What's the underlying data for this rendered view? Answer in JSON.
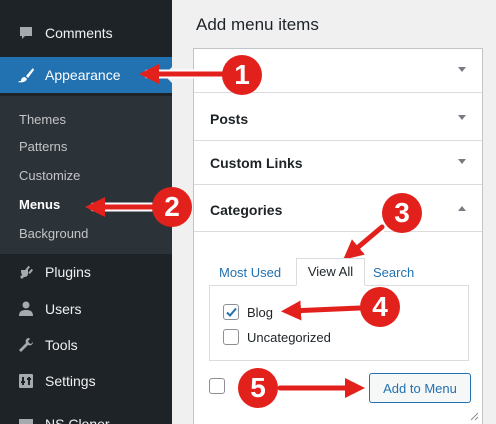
{
  "sidebar": {
    "items": [
      {
        "label": "Comments",
        "icon": "comments-icon"
      },
      {
        "label": "Appearance",
        "icon": "paintbrush-icon"
      },
      {
        "label": "Plugins",
        "icon": "plugins-icon"
      },
      {
        "label": "Users",
        "icon": "users-icon"
      },
      {
        "label": "Tools",
        "icon": "wrench-icon"
      },
      {
        "label": "Settings",
        "icon": "settings-icon"
      },
      {
        "label": "NS Cloner",
        "icon": "cloner-icon"
      }
    ],
    "submenu": [
      "Themes",
      "Patterns",
      "Customize",
      "Menus",
      "Background"
    ]
  },
  "main": {
    "title": "Add menu items",
    "sections": [
      "Posts",
      "Custom Links",
      "Categories"
    ],
    "tabs": [
      "Most Used",
      "View All",
      "Search"
    ],
    "categories": [
      {
        "label": "Blog",
        "checked": true
      },
      {
        "label": "Uncategorized",
        "checked": false
      }
    ],
    "add_button": "Add to Menu"
  },
  "annotations": [
    "1",
    "2",
    "3",
    "4",
    "5"
  ],
  "colors": {
    "sidebar": "#1d2327",
    "submenu": "#2c3338",
    "accent": "#2271b1",
    "annotation": "#e3211c"
  }
}
